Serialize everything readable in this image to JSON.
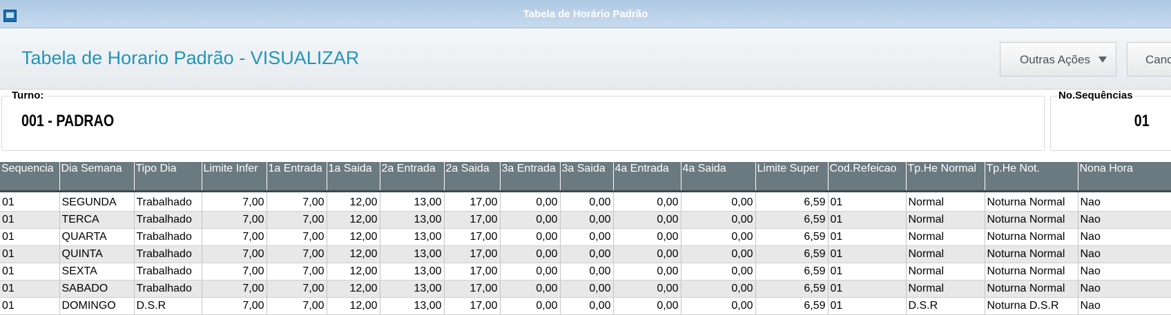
{
  "window": {
    "title": "Tabela de Horário Padrão"
  },
  "header": {
    "page_title": "Tabela de Horario Padrão - VISUALIZAR",
    "outras_acoes_label": "Outras Ações",
    "cancel_label": "Canc"
  },
  "fields": {
    "turno_label": "Turno:",
    "turno_value": "001 - PADRAO",
    "sequencias_label": "No.Sequências",
    "sequencias_value": "01"
  },
  "table": {
    "columns": [
      "Sequencia",
      "Dia Semana",
      "Tipo Dia",
      "Limite Infer",
      "1a Entrada",
      "1a Saida",
      "2a Entrada",
      "2a Saida",
      "3a Entrada",
      "3a Saida",
      "4a Entrada",
      "4a Saida",
      "Limite Super",
      "Cod.Refeicao",
      "Tp.He Normal",
      "Tp.He Not.",
      "Nona Hora"
    ],
    "rows": [
      [
        "01",
        "SEGUNDA",
        "Trabalhado",
        "7,00",
        "7,00",
        "12,00",
        "13,00",
        "17,00",
        "0,00",
        "0,00",
        "0,00",
        "0,00",
        "6,59",
        "01",
        "Normal",
        "Noturna Normal",
        "Nao"
      ],
      [
        "01",
        "TERCA",
        "Trabalhado",
        "7,00",
        "7,00",
        "12,00",
        "13,00",
        "17,00",
        "0,00",
        "0,00",
        "0,00",
        "0,00",
        "6,59",
        "01",
        "Normal",
        "Noturna Normal",
        "Nao"
      ],
      [
        "01",
        "QUARTA",
        "Trabalhado",
        "7,00",
        "7,00",
        "12,00",
        "13,00",
        "17,00",
        "0,00",
        "0,00",
        "0,00",
        "0,00",
        "6,59",
        "01",
        "Normal",
        "Noturna Normal",
        "Nao"
      ],
      [
        "01",
        "QUINTA",
        "Trabalhado",
        "7,00",
        "7,00",
        "12,00",
        "13,00",
        "17,00",
        "0,00",
        "0,00",
        "0,00",
        "0,00",
        "6,59",
        "01",
        "Normal",
        "Noturna Normal",
        "Nao"
      ],
      [
        "01",
        "SEXTA",
        "Trabalhado",
        "7,00",
        "7,00",
        "12,00",
        "13,00",
        "17,00",
        "0,00",
        "0,00",
        "0,00",
        "0,00",
        "6,59",
        "01",
        "Normal",
        "Noturna Normal",
        "Nao"
      ],
      [
        "01",
        "SABADO",
        "Trabalhado",
        "7,00",
        "7,00",
        "12,00",
        "13,00",
        "17,00",
        "0,00",
        "0,00",
        "0,00",
        "0,00",
        "6,59",
        "01",
        "Normal",
        "Noturna Normal",
        "Nao"
      ],
      [
        "01",
        "DOMINGO",
        "D.S.R",
        "7,00",
        "7,00",
        "12,00",
        "13,00",
        "17,00",
        "0,00",
        "0,00",
        "0,00",
        "0,00",
        "6,59",
        "01",
        "D.S.R",
        "Noturna D.S.R",
        "Nao"
      ]
    ]
  }
}
